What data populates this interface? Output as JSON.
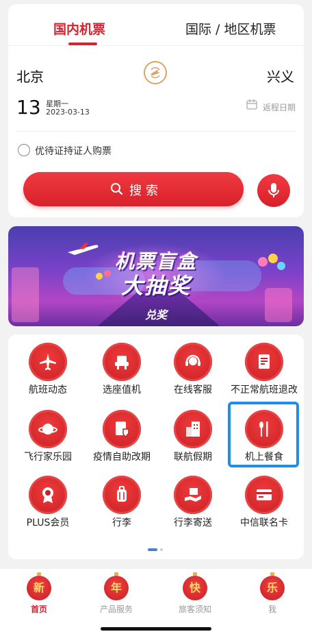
{
  "tabs": {
    "domestic": "国内机票",
    "international": "国际 / 地区机票"
  },
  "route": {
    "from": "北京",
    "to": "兴义"
  },
  "date": {
    "day": "13",
    "weekday": "星期一",
    "full": "2023-03-13",
    "return_label": "返程日期"
  },
  "option": {
    "label": "优待证持证人购票"
  },
  "search": {
    "label": "搜索"
  },
  "banner": {
    "title": "机票盲盒",
    "subtitle": "大抽奖",
    "button": "兑奖"
  },
  "services": [
    {
      "label": "航班动态",
      "icon": "airplane-icon"
    },
    {
      "label": "选座值机",
      "icon": "seat-icon"
    },
    {
      "label": "在线客服",
      "icon": "headset-icon"
    },
    {
      "label": "不正常航班退改",
      "icon": "document-icon"
    },
    {
      "label": "飞行家乐园",
      "icon": "planet-icon"
    },
    {
      "label": "疫情自助改期",
      "icon": "shield-doc-icon"
    },
    {
      "label": "联航假期",
      "icon": "building-icon"
    },
    {
      "label": "机上餐食",
      "icon": "cutlery-icon"
    },
    {
      "label": "PLUS会员",
      "icon": "medal-icon"
    },
    {
      "label": "行李",
      "icon": "luggage-icon"
    },
    {
      "label": "行李寄送",
      "icon": "delivery-icon"
    },
    {
      "label": "中信联名卡",
      "icon": "card-icon"
    }
  ],
  "tabbar": [
    {
      "glyph": "新",
      "label": "首页",
      "active": true
    },
    {
      "glyph": "年",
      "label": "产品服务",
      "active": false
    },
    {
      "glyph": "快",
      "label": "旅客须知",
      "active": false
    },
    {
      "glyph": "乐",
      "label": "我",
      "active": false
    }
  ],
  "colors": {
    "accent": "#d5232f",
    "highlight": "#1e8ee9",
    "gold": "#d9a36b"
  }
}
